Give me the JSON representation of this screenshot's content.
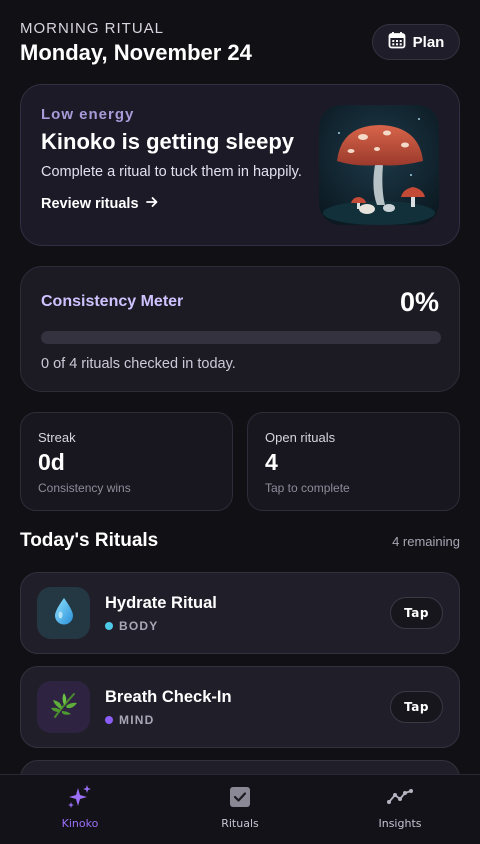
{
  "header": {
    "eyebrow": "MORNING RITUAL",
    "date": "Monday, November 24",
    "plan_label": "Plan"
  },
  "hero": {
    "tag": "Low energy",
    "title": "Kinoko is getting sleepy",
    "subtitle": "Complete a ritual to tuck them in happily.",
    "link_label": "Review rituals"
  },
  "meter": {
    "label": "Consistency Meter",
    "percent_text": "0%",
    "progress_fraction": 0,
    "note": "0 of 4 rituals checked in today."
  },
  "stats": [
    {
      "label": "Streak",
      "value": "0d",
      "sub": "Consistency wins"
    },
    {
      "label": "Open rituals",
      "value": "4",
      "sub": "Tap to complete"
    }
  ],
  "rituals_section": {
    "title": "Today's Rituals",
    "count": "4 remaining",
    "items": [
      {
        "name": "Hydrate Ritual",
        "category": "BODY",
        "icon": "water-drop-icon",
        "dot_color": "#4ec9e6",
        "icon_bg": "#243844",
        "action": "Tap"
      },
      {
        "name": "Breath Check-In",
        "category": "MIND",
        "icon": "herb-leaf-icon",
        "dot_color": "#8c5cf6",
        "icon_bg": "#2e2442",
        "action": "Tap"
      }
    ]
  },
  "tabs": [
    {
      "label": "Kinoko",
      "icon": "sparkles-icon",
      "active": true
    },
    {
      "label": "Rituals",
      "icon": "checkbox-icon",
      "active": false
    },
    {
      "label": "Insights",
      "icon": "line-chart-icon",
      "active": false
    }
  ],
  "colors": {
    "background": "#111015",
    "accent": "#9b6ff6",
    "card": "#1c1b24"
  }
}
